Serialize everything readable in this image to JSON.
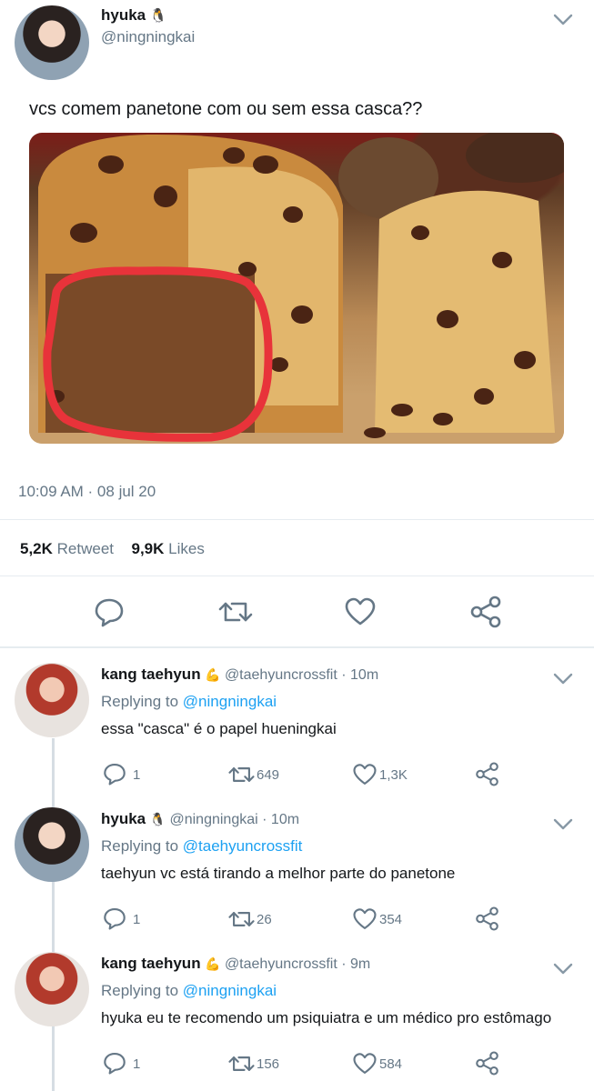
{
  "main_tweet": {
    "name": "hyuka",
    "name_emoji": "🐧",
    "handle": "@ningningkai",
    "text": "vcs comem panetone com ou sem essa casca??",
    "timestamp": "10:09 AM · 08 jul 20",
    "retweets_count": "5,2K",
    "retweets_label": "Retweet",
    "likes_count": "9,9K",
    "likes_label": "Likes"
  },
  "replies": [
    {
      "name": "kang taehyun",
      "name_emoji": "💪",
      "handle": "@taehyuncrossfit",
      "time": "· 10m",
      "replying_label": "Replying to",
      "replying_to": "@ningningkai",
      "text": "essa \"casca\" é o papel hueningkai",
      "reply_count": "1",
      "retweet_count": "649",
      "like_count": "1,3K"
    },
    {
      "name": "hyuka",
      "name_emoji": "🐧",
      "handle": "@ningningkai",
      "time": "· 10m",
      "replying_label": "Replying to",
      "replying_to": "@taehyuncrossfit",
      "text": "taehyun vc está tirando a melhor parte do panetone",
      "reply_count": "1",
      "retweet_count": "26",
      "like_count": "354"
    },
    {
      "name": "kang taehyun",
      "name_emoji": "💪",
      "handle": "@taehyuncrossfit",
      "time": "· 9m",
      "replying_label": "Replying to",
      "replying_to": "@ningningkai",
      "text": "hyuka eu te recomendo um psiquiatra e um médico pro estômago",
      "reply_count": "1",
      "retweet_count": "156",
      "like_count": "584"
    }
  ],
  "colors": {
    "accent": "#1da1f2",
    "muted": "#657786",
    "highlight_circle": "#e8333a"
  }
}
